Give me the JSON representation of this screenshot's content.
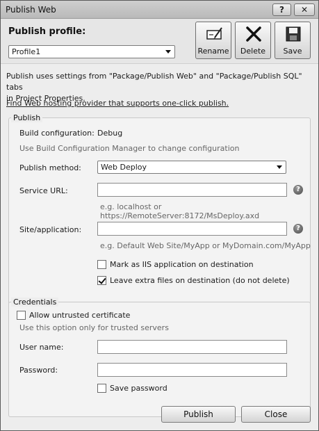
{
  "window": {
    "title": "Publish Web",
    "help_button": "?",
    "close_button": "✕"
  },
  "header": {
    "profile_label": "Publish profile:",
    "profile_selected": "Profile1",
    "rename_label": "Rename",
    "delete_label": "Delete",
    "save_label": "Save"
  },
  "info": {
    "description_line1": "Publish uses settings from \"Package/Publish Web\" and \"Package/Publish SQL\" tabs",
    "description_line2": "in Project Properties.",
    "hosting_link": "Find Web hosting provider that supports one-click publish."
  },
  "publish_group": {
    "title": "Publish",
    "build_config_label": "Build configuration:",
    "build_config_value": "Debug",
    "build_config_hint": "Use Build Configuration Manager to change configuration",
    "method_label": "Publish method:",
    "method_selected": "Web Deploy",
    "service_url_label": "Service URL:",
    "service_url_value": "",
    "service_url_hint": "e.g. localhost or https://RemoteServer:8172/MsDeploy.axd",
    "site_label": "Site/application:",
    "site_value": "",
    "site_hint": "e.g. Default Web Site/MyApp or MyDomain.com/MyApp",
    "mark_iis_label": "Mark as IIS application on destination",
    "mark_iis_checked": false,
    "leave_extra_label": "Leave extra files on destination (do not delete)",
    "leave_extra_checked": true
  },
  "credentials_group": {
    "title": "Credentials",
    "allow_untrusted_label": "Allow untrusted certificate",
    "allow_untrusted_checked": false,
    "allow_untrusted_hint": "Use this option only for trusted servers",
    "username_label": "User name:",
    "username_value": "",
    "password_label": "Password:",
    "password_value": "",
    "save_password_label": "Save password",
    "save_password_checked": false
  },
  "footer": {
    "publish_label": "Publish",
    "close_label": "Close"
  }
}
